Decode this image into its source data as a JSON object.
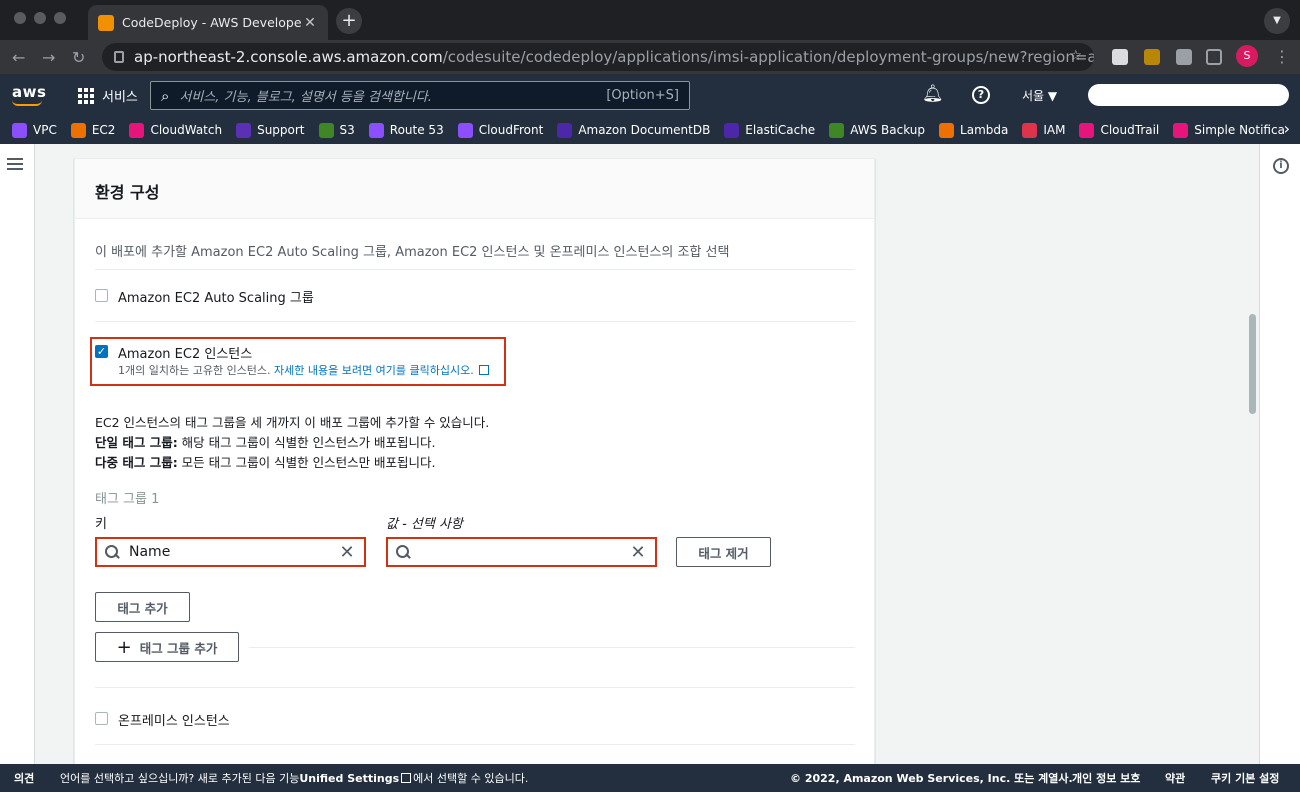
{
  "browser": {
    "tab_title": "CodeDeploy - AWS Developer",
    "url_host": "ap-northeast-2.console.aws.amazon.com",
    "url_path": "/codesuite/codedeploy/applications/imsi-application/deployment-groups/new?region=ap-n...",
    "profile_initial": "S"
  },
  "aws_nav": {
    "logo": "aws",
    "services_label": "서비스",
    "search_placeholder": "서비스, 기능, 블로그, 설명서 등을 검색합니다.",
    "search_shortcut": "[Option+S]",
    "region": "서울 ▼"
  },
  "favorites": [
    {
      "label": "VPC",
      "color": "#8c4fff"
    },
    {
      "label": "EC2",
      "color": "#ed7100"
    },
    {
      "label": "CloudWatch",
      "color": "#e7157b"
    },
    {
      "label": "Support",
      "color": "#5a30b5"
    },
    {
      "label": "S3",
      "color": "#3f8624"
    },
    {
      "label": "Route 53",
      "color": "#8c4fff"
    },
    {
      "label": "CloudFront",
      "color": "#8c4fff"
    },
    {
      "label": "Amazon DocumentDB",
      "color": "#4d27aa"
    },
    {
      "label": "ElastiCache",
      "color": "#4d27aa"
    },
    {
      "label": "AWS Backup",
      "color": "#3f8624"
    },
    {
      "label": "Lambda",
      "color": "#ed7100"
    },
    {
      "label": "IAM",
      "color": "#dd344c"
    },
    {
      "label": "CloudTrail",
      "color": "#e7157b"
    },
    {
      "label": "Simple Notifica",
      "color": "#e7157b"
    }
  ],
  "section": {
    "title": "환경 구성",
    "description": "이 배포에 추가할 Amazon EC2 Auto Scaling 그룹, Amazon EC2 인스턴스 및 온프레미스 인스턴스의 조합 선택",
    "asg_label": "Amazon EC2 Auto Scaling 그룹",
    "asg_checked": false,
    "ec2_label": "Amazon EC2 인스턴스",
    "ec2_checked": true,
    "ec2_match": "1개의 일치하는 고유한 인스턴스.",
    "ec2_link": "자세한 내용을 보려면 여기를 클릭하십시오.",
    "info_line1": "EC2 인스턴스의 태그 그룹을 세 개까지 이 배포 그룹에 추가할 수 있습니다.",
    "info_single_bold": "단일 태그 그룹:",
    "info_single_text": " 해당 태그 그룹이 식별한 인스턴스가 배포됩니다.",
    "info_multi_bold": "다중 태그 그룹:",
    "info_multi_text": " 모든 태그 그룹이 식별한 인스턴스만 배포됩니다.",
    "tag_group_label": "태그 그룹 1",
    "key_label": "키",
    "value_label": "값 - 선택 사항",
    "key_value": "Name",
    "value_value": "",
    "remove_tag_button": "태그 제거",
    "add_tag_button": "태그 추가",
    "add_tag_group_button": "태그 그룹 추가",
    "onprem_label": "온프레미스 인스턴스",
    "onprem_checked": false
  },
  "footer": {
    "feedback": "의견",
    "notice_pre": "언어를 선택하고 싶으십니까? 새로 추가된 다음 기능",
    "notice_bold": "Unified Settings",
    "notice_post": "에서 선택할 수 있습니다.",
    "copyright": "© 2022, Amazon Web Services, Inc. 또는 계열사.",
    "privacy": "개인 정보 보호",
    "terms": "약관",
    "cookies": "쿠키 기본 설정"
  }
}
